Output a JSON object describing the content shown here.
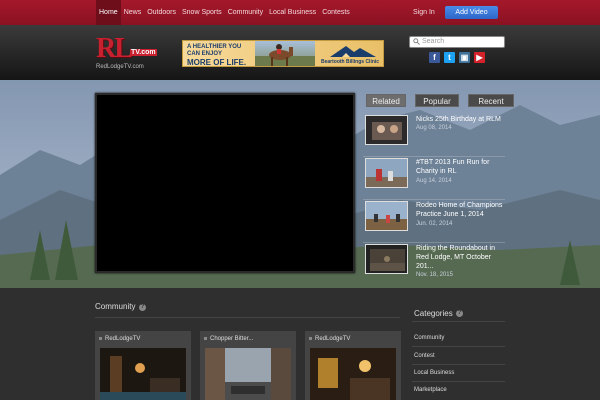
{
  "nav": {
    "items": [
      "Home",
      "News",
      "Outdoors",
      "Snow Sports",
      "Community",
      "Local Business",
      "Contests"
    ],
    "signin": "Sign In",
    "add_video": "Add Video"
  },
  "logo": {
    "mark": "RL",
    "tv": "TV.com",
    "site": "RedLodgeTV.com"
  },
  "ad": {
    "line1": "A HEALTHIER YOU",
    "line2": "CAN ENJOY",
    "line3": "MORE OF LIFE.",
    "clinic": "Beartooth Billings Clinic"
  },
  "search": {
    "placeholder": "Search"
  },
  "social": {
    "facebook": "f",
    "twitter": "t",
    "instagram": "▣",
    "youtube": "▶"
  },
  "tabs": [
    "Related",
    "Popular",
    "Recent"
  ],
  "videos": [
    {
      "title": "Nicks 25th Birthday at RLM",
      "date": "Aug 08, 2014"
    },
    {
      "title": "#TBT 2013 Fun Run for Charity in RL",
      "date": "Aug 14, 2014"
    },
    {
      "title": "Rodeo Home of Champions Practice June 1, 2014",
      "date": "Jun. 02, 2014"
    },
    {
      "title": "Riding the Roundabout in Red Lodge, MT October 201...",
      "date": "Nov. 18, 2015"
    }
  ],
  "community": {
    "title": "Community",
    "cards": [
      {
        "title": "RedLodgeTV"
      },
      {
        "title": "Chopper Bitter..."
      },
      {
        "title": "RedLodgeTV"
      }
    ]
  },
  "categories": {
    "title": "Categories",
    "items": [
      "Community",
      "Contest",
      "Local Business",
      "Marketplace"
    ]
  },
  "colors": {
    "nav_red": "#a5182b",
    "add_button": "#2c66c8"
  }
}
